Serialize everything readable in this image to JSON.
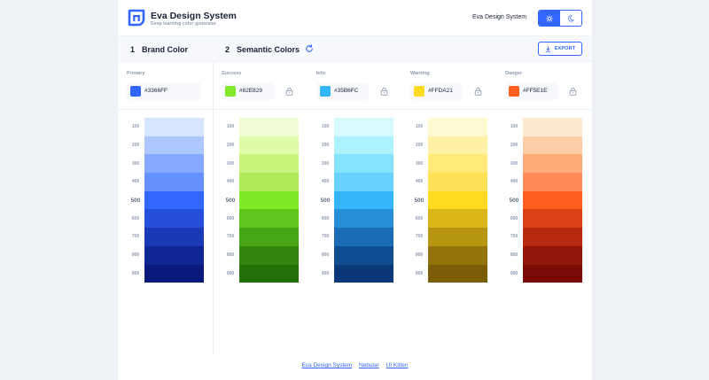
{
  "header": {
    "title": "Eva Design System",
    "subtitle": "Deep learning color generator",
    "link": "Eva Design System"
  },
  "theme": {
    "light_icon": "sun-icon",
    "dark_icon": "moon-icon"
  },
  "sections": {
    "brand_num": "1",
    "brand_title": "Brand Color",
    "semantic_num": "2",
    "semantic_title": "Semantic Colors",
    "export_label": "EXPORT"
  },
  "shade_levels": [
    "100",
    "200",
    "300",
    "400",
    "500",
    "600",
    "700",
    "800",
    "900"
  ],
  "columns": [
    {
      "label": "Primary",
      "hex": "#3366FF",
      "color": "#3366ff",
      "shades": [
        "#d6e4ff",
        "#adc8ff",
        "#84a9ff",
        "#6690ff",
        "#3366ff",
        "#254edb",
        "#1939b7",
        "#102693",
        "#091a7a"
      ]
    },
    {
      "label": "Success",
      "hex": "#82E829",
      "color": "#82e829",
      "shades": [
        "#f1fdd3",
        "#e0fba8",
        "#c8f57b",
        "#aeeb58",
        "#82e829",
        "#62c71d",
        "#48a514",
        "#31850d",
        "#226e07"
      ]
    },
    {
      "label": "Info",
      "hex": "#35B6FC",
      "color": "#35b6fc",
      "shades": [
        "#d5fbfe",
        "#aef2fe",
        "#85e3fe",
        "#67d2fd",
        "#35b6fc",
        "#268fd8",
        "#1a6cb5",
        "#104e91",
        "#0a3878"
      ]
    },
    {
      "label": "Warning",
      "hex": "#FFDA21",
      "color": "#ffda21",
      "shades": [
        "#fff9d2",
        "#fff1a6",
        "#ffe979",
        "#ffe158",
        "#ffda21",
        "#dbb618",
        "#b79510",
        "#93740a",
        "#7a5d06"
      ]
    },
    {
      "label": "Danger",
      "hex": "#FF5E1E",
      "color": "#ff5e1e",
      "shades": [
        "#ffe9d2",
        "#ffcda5",
        "#ffab78",
        "#ff8b56",
        "#ff5e1e",
        "#db4115",
        "#b72a0f",
        "#931709",
        "#7a0a05"
      ]
    }
  ],
  "footer": {
    "links": [
      "Eva Design System",
      "Nebular",
      "UI Kitten"
    ]
  }
}
